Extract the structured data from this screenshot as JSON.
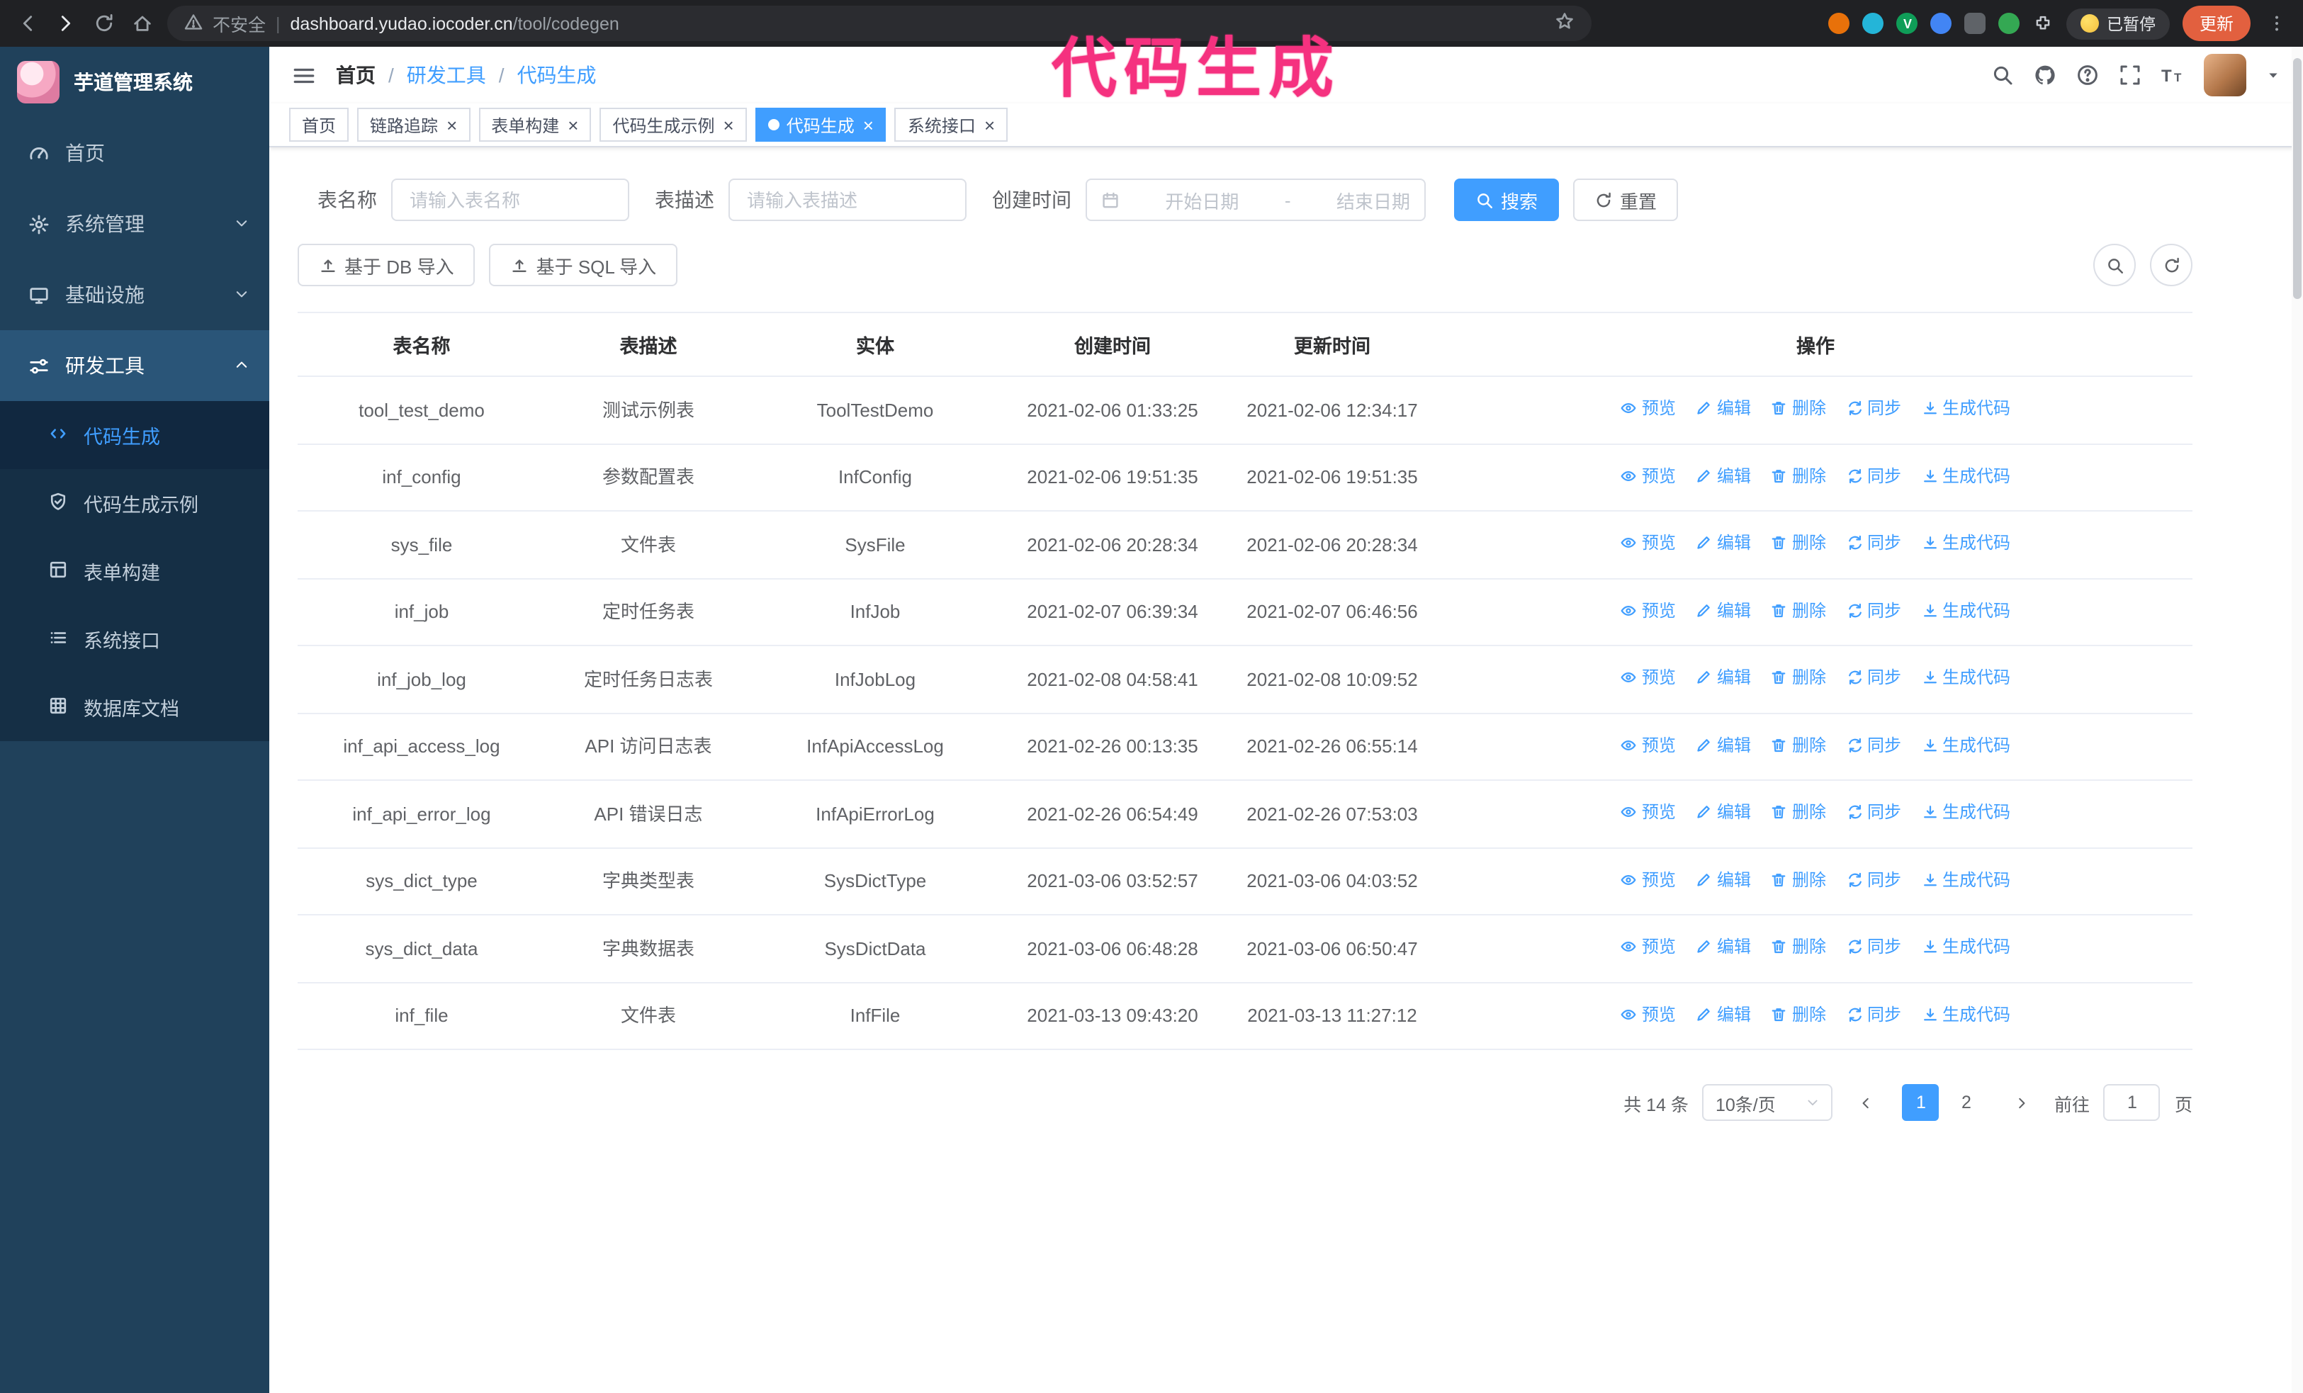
{
  "browser": {
    "security_label": "不安全",
    "url_domain": "dashboard.yudao.iocoder.cn",
    "url_path": "/tool/codegen",
    "paused_badge": "已暂停",
    "update_button": "更新"
  },
  "annotation": {
    "text": "代码生成"
  },
  "colors": {
    "accent": "#409eff",
    "annotation": "#f5317f",
    "sidebar": "#20415b"
  },
  "sidebar": {
    "app_title": "芋道管理系统",
    "items": [
      {
        "key": "home",
        "icon": "gauge-icon",
        "label": "首页"
      },
      {
        "key": "system",
        "icon": "gear-icon",
        "label": "系统管理",
        "chevron": "down"
      },
      {
        "key": "infra",
        "icon": "monitor-icon",
        "label": "基础设施",
        "chevron": "down"
      },
      {
        "key": "devtools",
        "icon": "sliders-icon",
        "label": "研发工具",
        "chevron": "up",
        "expanded": true,
        "children": [
          {
            "key": "codegen",
            "icon": "code-icon",
            "label": "代码生成",
            "active": true
          },
          {
            "key": "codegen-example",
            "icon": "shield-icon",
            "label": "代码生成示例"
          },
          {
            "key": "form-builder",
            "icon": "form-icon",
            "label": "表单构建"
          },
          {
            "key": "system-api",
            "icon": "list-icon",
            "label": "系统接口"
          },
          {
            "key": "db-doc",
            "icon": "grid-icon",
            "label": "数据库文档"
          }
        ]
      }
    ]
  },
  "header": {
    "breadcrumb": [
      "首页",
      "研发工具",
      "代码生成"
    ]
  },
  "tabs": [
    {
      "key": "home",
      "label": "首页",
      "closable": false,
      "active": false
    },
    {
      "key": "tracing",
      "label": "链路追踪",
      "closable": true,
      "active": false
    },
    {
      "key": "form-builder",
      "label": "表单构建",
      "closable": true,
      "active": false
    },
    {
      "key": "codegen-example",
      "label": "代码生成示例",
      "closable": true,
      "active": false
    },
    {
      "key": "codegen",
      "label": "代码生成",
      "closable": true,
      "active": true
    },
    {
      "key": "system-api",
      "label": "系统接口",
      "closable": true,
      "active": false
    }
  ],
  "filters": {
    "table_name_label": "表名称",
    "table_name_placeholder": "请输入表名称",
    "table_desc_label": "表描述",
    "table_desc_placeholder": "请输入表描述",
    "create_time_label": "创建时间",
    "date_start_placeholder": "开始日期",
    "date_separator": "-",
    "date_end_placeholder": "结束日期",
    "search_button": "搜索",
    "reset_button": "重置"
  },
  "toolbar": {
    "import_db_button": "基于 DB 导入",
    "import_sql_button": "基于 SQL 导入"
  },
  "table": {
    "columns": [
      "表名称",
      "表描述",
      "实体",
      "创建时间",
      "更新时间",
      "操作"
    ],
    "actions": [
      {
        "key": "preview",
        "label": "预览",
        "icon": "eye-icon"
      },
      {
        "key": "edit",
        "label": "编辑",
        "icon": "edit-icon"
      },
      {
        "key": "delete",
        "label": "删除",
        "icon": "trash-icon"
      },
      {
        "key": "sync",
        "label": "同步",
        "icon": "sync-icon"
      },
      {
        "key": "generate",
        "label": "生成代码",
        "icon": "download-icon"
      }
    ],
    "rows": [
      {
        "name": "tool_test_demo",
        "desc": "测试示例表",
        "entity": "ToolTestDemo",
        "created": "2021-02-06 01:33:25",
        "updated": "2021-02-06 12:34:17"
      },
      {
        "name": "inf_config",
        "desc": "参数配置表",
        "entity": "InfConfig",
        "created": "2021-02-06 19:51:35",
        "updated": "2021-02-06 19:51:35"
      },
      {
        "name": "sys_file",
        "desc": "文件表",
        "entity": "SysFile",
        "created": "2021-02-06 20:28:34",
        "updated": "2021-02-06 20:28:34"
      },
      {
        "name": "inf_job",
        "desc": "定时任务表",
        "entity": "InfJob",
        "created": "2021-02-07 06:39:34",
        "updated": "2021-02-07 06:46:56"
      },
      {
        "name": "inf_job_log",
        "desc": "定时任务日志表",
        "entity": "InfJobLog",
        "created": "2021-02-08 04:58:41",
        "updated": "2021-02-08 10:09:52"
      },
      {
        "name": "inf_api_access_log",
        "desc": "API 访问日志表",
        "entity": "InfApiAccessLog",
        "created": "2021-02-26 00:13:35",
        "updated": "2021-02-26 06:55:14"
      },
      {
        "name": "inf_api_error_log",
        "desc": "API 错误日志",
        "entity": "InfApiErrorLog",
        "created": "2021-02-26 06:54:49",
        "updated": "2021-02-26 07:53:03"
      },
      {
        "name": "sys_dict_type",
        "desc": "字典类型表",
        "entity": "SysDictType",
        "created": "2021-03-06 03:52:57",
        "updated": "2021-03-06 04:03:52"
      },
      {
        "name": "sys_dict_data",
        "desc": "字典数据表",
        "entity": "SysDictData",
        "created": "2021-03-06 06:48:28",
        "updated": "2021-03-06 06:50:47"
      },
      {
        "name": "inf_file",
        "desc": "文件表",
        "entity": "InfFile",
        "created": "2021-03-13 09:43:20",
        "updated": "2021-03-13 11:27:12"
      }
    ]
  },
  "pagination": {
    "total_text": "共 14 条",
    "page_size": "10条/页",
    "pages": [
      "1",
      "2"
    ],
    "active_page": "1",
    "goto_label": "前往",
    "goto_value": "1",
    "goto_unit": "页"
  }
}
